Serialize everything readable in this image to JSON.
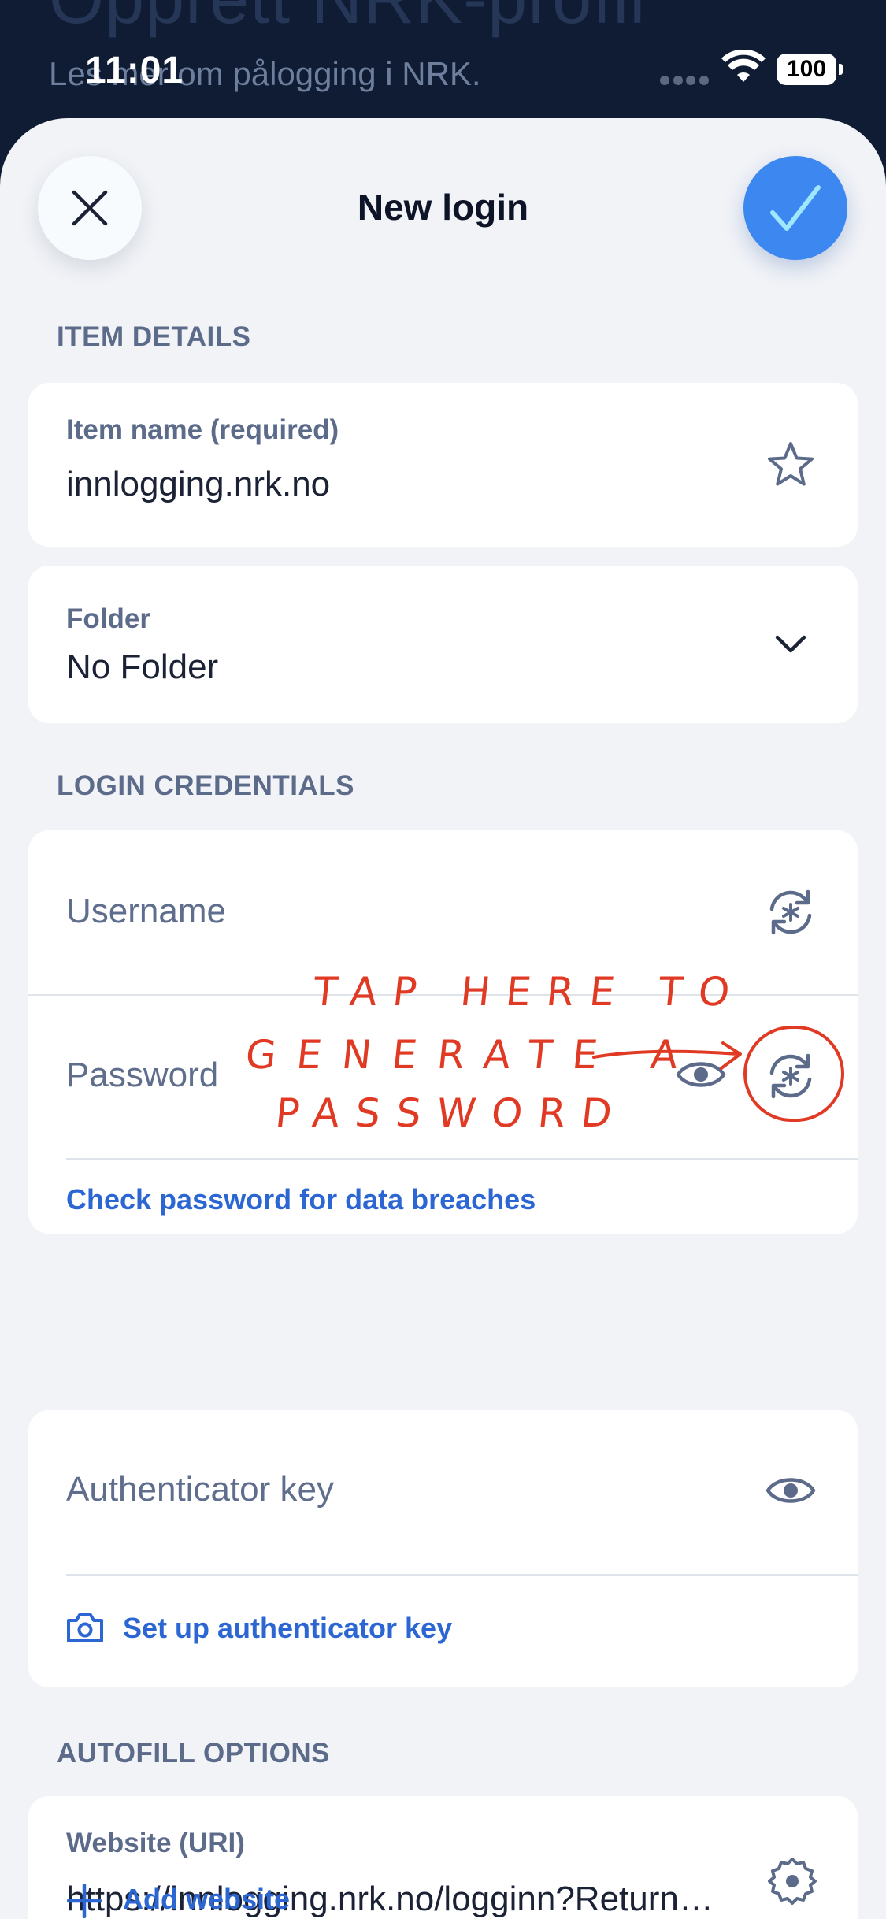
{
  "background": {
    "title": "Opprett NRK-profil",
    "subtitle": "Les mer om pålogging i NRK."
  },
  "status_bar": {
    "time": "11:01",
    "battery": "100"
  },
  "header": {
    "title": "New login",
    "close_icon": "close-icon",
    "save_icon": "checkmark-icon"
  },
  "sections": {
    "item_details": "ITEM DETAILS",
    "login_credentials": "LOGIN CREDENTIALS",
    "autofill_options": "AUTOFILL OPTIONS"
  },
  "item_name": {
    "label": "Item name (required)",
    "value": "innlogging.nrk.no",
    "icon": "star-icon"
  },
  "folder": {
    "label": "Folder",
    "value": "No Folder",
    "icon": "chevron-down-icon"
  },
  "username": {
    "placeholder": "Username",
    "icon": "generate-icon"
  },
  "password": {
    "placeholder": "Password",
    "show_icon": "eye-icon",
    "generate_icon": "generate-icon",
    "check_link": "Check password for data breaches"
  },
  "annotation": {
    "line1": "TAP HERE TO",
    "line2": "GENERATE A",
    "line3": "PASSWORD"
  },
  "authenticator": {
    "placeholder": "Authenticator key",
    "show_icon": "eye-icon",
    "setup_link": "Set up authenticator key",
    "setup_icon": "camera-icon"
  },
  "website": {
    "label": "Website (URI)",
    "value": "https://innlogging.nrk.no/logginn?Return…",
    "icon": "gear-icon",
    "add_link": "Add website",
    "add_icon": "plus-icon"
  },
  "colors": {
    "accent": "#3c87f0",
    "link": "#2b66d3",
    "annotation": "#e03a24",
    "sheet_background": "#f1f3f7"
  }
}
